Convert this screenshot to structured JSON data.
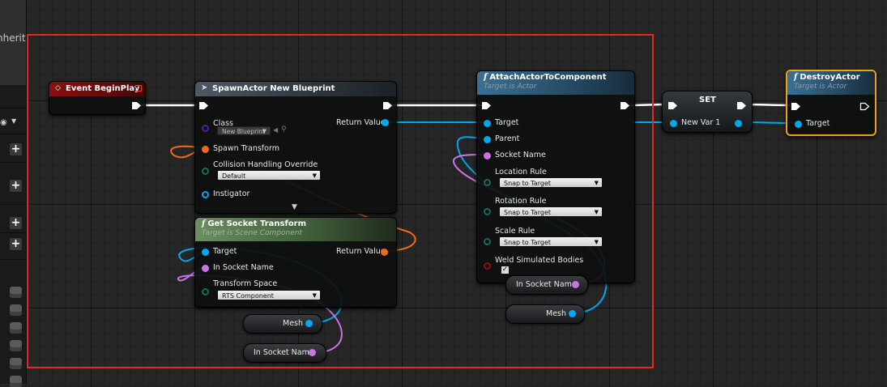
{
  "side_panel": {
    "inherit_text": "nherit"
  },
  "colors": {
    "selection": "#e22a2a",
    "exec_wire": "#ffffff",
    "object_pin": "#00a8f2",
    "struct_pin": "#ef6a1e",
    "name_pin": "#c874e6",
    "bool_pin": "#8e1010",
    "class_pin": "#5a1aa8"
  },
  "nodes": {
    "event_begin_play": {
      "title": "Event BeginPlay"
    },
    "spawn_actor": {
      "title": "SpawnActor New Blueprint",
      "class_label": "Class",
      "class_value": "New Blueprint",
      "return_label": "Return Value",
      "spawn_transform_label": "Spawn Transform",
      "collision_label": "Collision Handling Override",
      "collision_value": "Default",
      "instigator_label": "Instigator"
    },
    "get_socket_transform": {
      "title": "Get Socket Transform",
      "subtitle": "Target is Scene Component",
      "target_label": "Target",
      "return_label": "Return Value",
      "socket_label": "In Socket Name",
      "space_label": "Transform Space",
      "space_value": "RTS Component"
    },
    "attach_actor": {
      "title": "AttachActorToComponent",
      "subtitle": "Target is Actor",
      "target_label": "Target",
      "parent_label": "Parent",
      "socket_label": "Socket Name",
      "location_rule_label": "Location Rule",
      "location_rule_value": "Snap to Target",
      "rotation_rule_label": "Rotation Rule",
      "rotation_rule_value": "Snap to Target",
      "scale_rule_label": "Scale Rule",
      "scale_rule_value": "Snap to Target",
      "weld_label": "Weld Simulated Bodies",
      "weld_checked": true
    },
    "set_node": {
      "title": "SET",
      "var_label": "New Var 1"
    },
    "destroy_actor": {
      "title": "DestroyActor",
      "subtitle": "Target is Actor",
      "target_label": "Target"
    },
    "var_mesh_left": {
      "label": "Mesh"
    },
    "var_socket_left": {
      "label": "In Socket Name"
    },
    "var_socket_right": {
      "label": "In Socket Name"
    },
    "var_mesh_right": {
      "label": "Mesh"
    }
  }
}
